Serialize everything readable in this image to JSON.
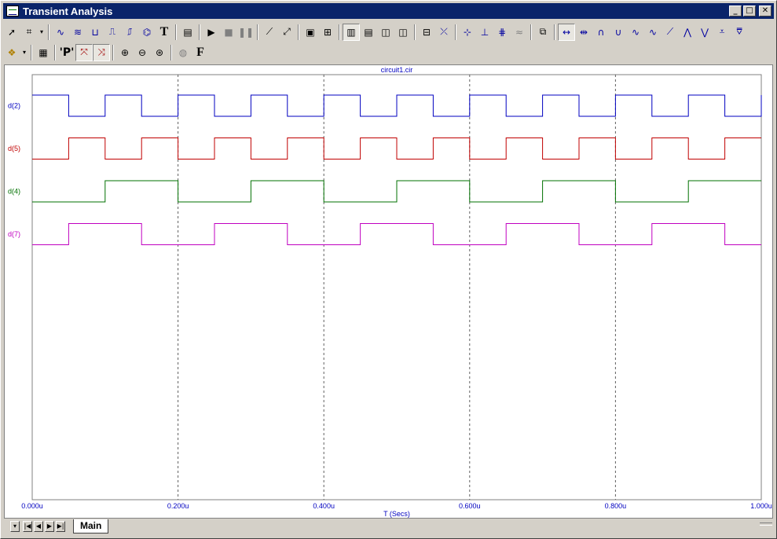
{
  "window": {
    "title": "Transient Analysis",
    "buttons": [
      "_",
      "□",
      "✕"
    ]
  },
  "toolbar1": {
    "icons": [
      "select-arrow-icon",
      "scale-icon",
      "dropdown-arrow-icon",
      "waveform-icon",
      "bode-icon",
      "histogram-icon",
      "step-icon",
      "peak-icon",
      "fourier-icon",
      "text-tool-icon",
      "properties-icon",
      "run-icon",
      "stop-icon",
      "pause-icon",
      "line-icon",
      "cursor-line-icon",
      "grid-icon",
      "grid-fine-icon",
      "layout-1-icon",
      "layout-2-icon",
      "layout-3-icon",
      "layout-4-icon",
      "tokens-icon",
      "axis-icon",
      "point-icon",
      "trace-icon",
      "tag-icon",
      "wave-icon",
      "peak-next-icon",
      "valley-icon",
      "high-icon",
      "low-icon",
      "inflection-icon",
      "slope-icon",
      "global-high-icon",
      "global-low-icon",
      "top-icon",
      "bottom-icon"
    ]
  },
  "toolbar2": {
    "icons": [
      "settings-icon",
      "dropdown-arrow-icon",
      "spreadsheet-icon",
      "data-points-icon",
      "x-axis-icon",
      "y-axis-icon",
      "zoom-in-icon",
      "zoom-out-icon",
      "zoom-fit-icon",
      "globe-icon",
      "font-icon"
    ],
    "p_label": "'P'",
    "f_label": "F"
  },
  "chart_data": {
    "type": "line",
    "title": "circuit1.cir",
    "xlabel": "T (Secs)",
    "xlim": [
      0,
      1.0
    ],
    "x_tick_labels": [
      "0.000u",
      "0.200u",
      "0.400u",
      "0.600u",
      "0.800u",
      "1.000u"
    ],
    "x_ticks": [
      0,
      0.2,
      0.4,
      0.6,
      0.8,
      1.0
    ],
    "grid": "vertical dashed",
    "series": [
      {
        "name": "d(2)",
        "color": "#0000c0",
        "high_intervals": [
          [
            0,
            0.05
          ],
          [
            0.1,
            0.15
          ],
          [
            0.2,
            0.25
          ],
          [
            0.3,
            0.35
          ],
          [
            0.4,
            0.45
          ],
          [
            0.5,
            0.55
          ],
          [
            0.6,
            0.65
          ],
          [
            0.7,
            0.75
          ],
          [
            0.8,
            0.85
          ],
          [
            0.9,
            0.95
          ],
          [
            1.0,
            1.0
          ]
        ]
      },
      {
        "name": "d(5)",
        "color": "#c00000",
        "high_intervals": [
          [
            0.05,
            0.1
          ],
          [
            0.15,
            0.2
          ],
          [
            0.25,
            0.3
          ],
          [
            0.35,
            0.4
          ],
          [
            0.45,
            0.5
          ],
          [
            0.55,
            0.6
          ],
          [
            0.65,
            0.7
          ],
          [
            0.75,
            0.8
          ],
          [
            0.85,
            0.9
          ],
          [
            0.95,
            1.0
          ]
        ]
      },
      {
        "name": "d(4)",
        "color": "#007000",
        "high_intervals": [
          [
            0.1,
            0.2
          ],
          [
            0.3,
            0.4
          ],
          [
            0.5,
            0.6
          ],
          [
            0.7,
            0.8
          ],
          [
            0.9,
            1.0
          ]
        ]
      },
      {
        "name": "d(7)",
        "color": "#c000c0",
        "high_intervals": [
          [
            0.05,
            0.15
          ],
          [
            0.25,
            0.35
          ],
          [
            0.45,
            0.55
          ],
          [
            0.65,
            0.75
          ],
          [
            0.85,
            0.95
          ]
        ]
      }
    ]
  },
  "bottom": {
    "tab_label": "Main",
    "nav_buttons": [
      "▾",
      "|◀",
      "◀",
      "▶",
      "▶|"
    ]
  }
}
